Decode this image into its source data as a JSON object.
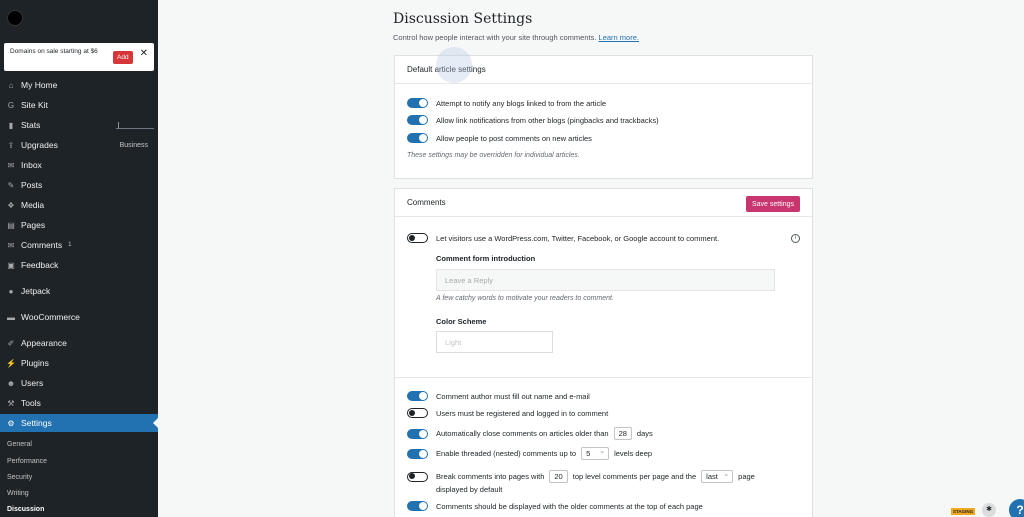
{
  "promo": {
    "text": "Domains on sale starting at $6",
    "add_label": "Add",
    "close_icon": "close-icon"
  },
  "sidebar": {
    "items": [
      {
        "label": "My Home",
        "icon": "home-icon"
      },
      {
        "label": "Site Kit",
        "icon": "sitekit-icon"
      },
      {
        "label": "Stats",
        "icon": "stats-icon"
      },
      {
        "label": "Upgrades",
        "icon": "upgrades-icon",
        "right": "Business"
      },
      {
        "label": "Inbox",
        "icon": "inbox-icon"
      },
      {
        "label": "Posts",
        "icon": "pin-icon"
      },
      {
        "label": "Media",
        "icon": "media-icon"
      },
      {
        "label": "Pages",
        "icon": "pages-icon"
      },
      {
        "label": "Comments",
        "icon": "comments-icon",
        "badge": "1"
      },
      {
        "label": "Feedback",
        "icon": "feedback-icon"
      },
      {
        "label": "Jetpack",
        "icon": "jetpack-icon"
      },
      {
        "label": "WooCommerce",
        "icon": "woocommerce-icon"
      },
      {
        "label": "Appearance",
        "icon": "brush-icon"
      },
      {
        "label": "Plugins",
        "icon": "plugin-icon"
      },
      {
        "label": "Users",
        "icon": "users-icon"
      },
      {
        "label": "Tools",
        "icon": "wrench-icon"
      },
      {
        "label": "Settings",
        "icon": "settings-icon"
      }
    ],
    "submenu": [
      "General",
      "Performance",
      "Security",
      "Writing",
      "Discussion"
    ]
  },
  "page": {
    "title": "Discussion Settings",
    "subtitle": "Control how people interact with your site through comments.",
    "learn_more": "Learn more."
  },
  "default_settings": {
    "header": "Default article settings",
    "items": [
      "Attempt to notify any blogs linked to from the article",
      "Allow link notifications from other blogs (pingbacks and trackbacks)",
      "Allow people to post comments on new articles"
    ],
    "note": "These settings may be overridden for individual articles."
  },
  "comments": {
    "header": "Comments",
    "save_label": "Save settings",
    "social_login": "Let visitors use a WordPress.com, Twitter, Facebook, or Google account to comment.",
    "form_intro_label": "Comment form introduction",
    "form_intro_placeholder": "Leave a Reply",
    "form_intro_hint": "A few catchy words to motivate your readers to comment.",
    "color_scheme_label": "Color Scheme",
    "color_scheme_value": "Light",
    "author_fill": "Comment author must fill out name and e-mail",
    "must_register": "Users must be registered and logged in to comment",
    "auto_close_pre": "Automatically close comments on articles older than",
    "auto_close_value": "28",
    "auto_close_post": "days",
    "threaded_pre": "Enable threaded (nested) comments up to",
    "threaded_value": "5",
    "threaded_post": "levels deep",
    "break_pre": "Break comments into pages with",
    "break_value": "20",
    "break_mid": "top level comments per page and the",
    "break_select": "last",
    "break_post": "page",
    "break_line2": "displayed by default",
    "older_top": "Comments should be displayed with the older comments at the top of each page"
  },
  "footer": {
    "staging_badge": "STAGING",
    "help_label": "?"
  },
  "colors": {
    "sidebar_bg": "#1d2327",
    "accent": "#2271b1",
    "save_button": "#c9356e",
    "promo_add": "#d63638"
  }
}
